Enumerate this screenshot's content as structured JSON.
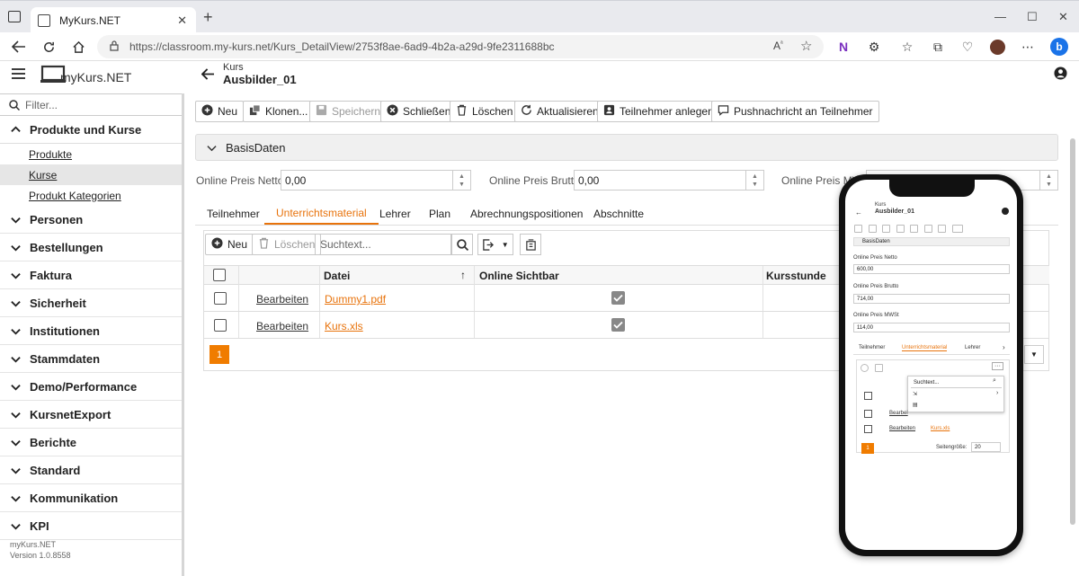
{
  "browser": {
    "tab_title": "MyKurs.NET",
    "url": "https://classroom.my-kurs.net/Kurs_DetailView/2753f8ae-6ad9-4b2a-a29d-9fe2311688bc"
  },
  "app": {
    "logo": "myKurs.NET",
    "header_kicker": "Kurs",
    "header_title": "Ausbilder_01"
  },
  "sidebar": {
    "filter_placeholder": "Filter...",
    "groups": [
      {
        "label": "Produkte und Kurse",
        "expanded": true,
        "items": [
          "Produkte",
          "Kurse",
          "Produkt Kategorien"
        ],
        "selected": "Kurse"
      },
      {
        "label": "Personen"
      },
      {
        "label": "Bestellungen"
      },
      {
        "label": "Faktura"
      },
      {
        "label": "Sicherheit"
      },
      {
        "label": "Institutionen"
      },
      {
        "label": "Stammdaten"
      },
      {
        "label": "Demo/Performance"
      },
      {
        "label": "KursnetExport"
      },
      {
        "label": "Berichte"
      },
      {
        "label": "Standard"
      },
      {
        "label": "Kommunikation"
      },
      {
        "label": "KPI"
      }
    ],
    "footer_name": "myKurs.NET",
    "footer_version": "Version 1.0.8558"
  },
  "toolbar": {
    "new": "Neu",
    "clone": "Klonen...",
    "save": "Speichern",
    "close": "Schließen",
    "delete": "Löschen",
    "refresh": "Aktualisieren",
    "add_participant": "Teilnehmer anlegen",
    "push": "Pushnachricht an Teilnehmer"
  },
  "basis": {
    "section_label": "BasisDaten",
    "net_label": "Online Preis Netto",
    "net_value": "0,00",
    "gross_label": "Online Preis Brutto",
    "gross_value": "0,00",
    "mwst_label": "Online Preis MWS"
  },
  "tabs": [
    "Teilnehmer",
    "Unterrichtsmaterial",
    "Lehrer",
    "Plan",
    "Abrechnungspositionen",
    "Abschnitte"
  ],
  "active_tab": "Unterrichtsmaterial",
  "grid": {
    "new": "Neu",
    "delete": "Löschen",
    "search_placeholder": "Suchtext...",
    "columns": [
      "Datei",
      "Online Sichtbar",
      "Kursstunde"
    ],
    "edit_label": "Bearbeiten",
    "rows": [
      {
        "file": "Dummy1.pdf",
        "visible": true
      },
      {
        "file": "Kurs.xls",
        "visible": true
      }
    ],
    "page": "1"
  },
  "phone": {
    "kicker": "Kurs",
    "title": "Ausbilder_01",
    "section": "BasisDaten",
    "net_label": "Online Preis Netto",
    "net_value": "600,00",
    "gross_label": "Online Preis Brutto",
    "gross_value": "714,00",
    "mwst_label": "Online Preis MWSt",
    "mwst_value": "114,00",
    "tabs": [
      "Teilnehmer",
      "Unterrichtsmaterial",
      "Lehrer"
    ],
    "search_placeholder": "Suchtext...",
    "row1_edit": "Bearbei",
    "row2_edit": "Bearbeiten",
    "row2_file": "Kurs.xls",
    "page": "1",
    "page_size_label": "Seitengröße:",
    "page_size": "20"
  },
  "colors": {
    "accent": "#f07c00",
    "link": "#e8730c"
  }
}
